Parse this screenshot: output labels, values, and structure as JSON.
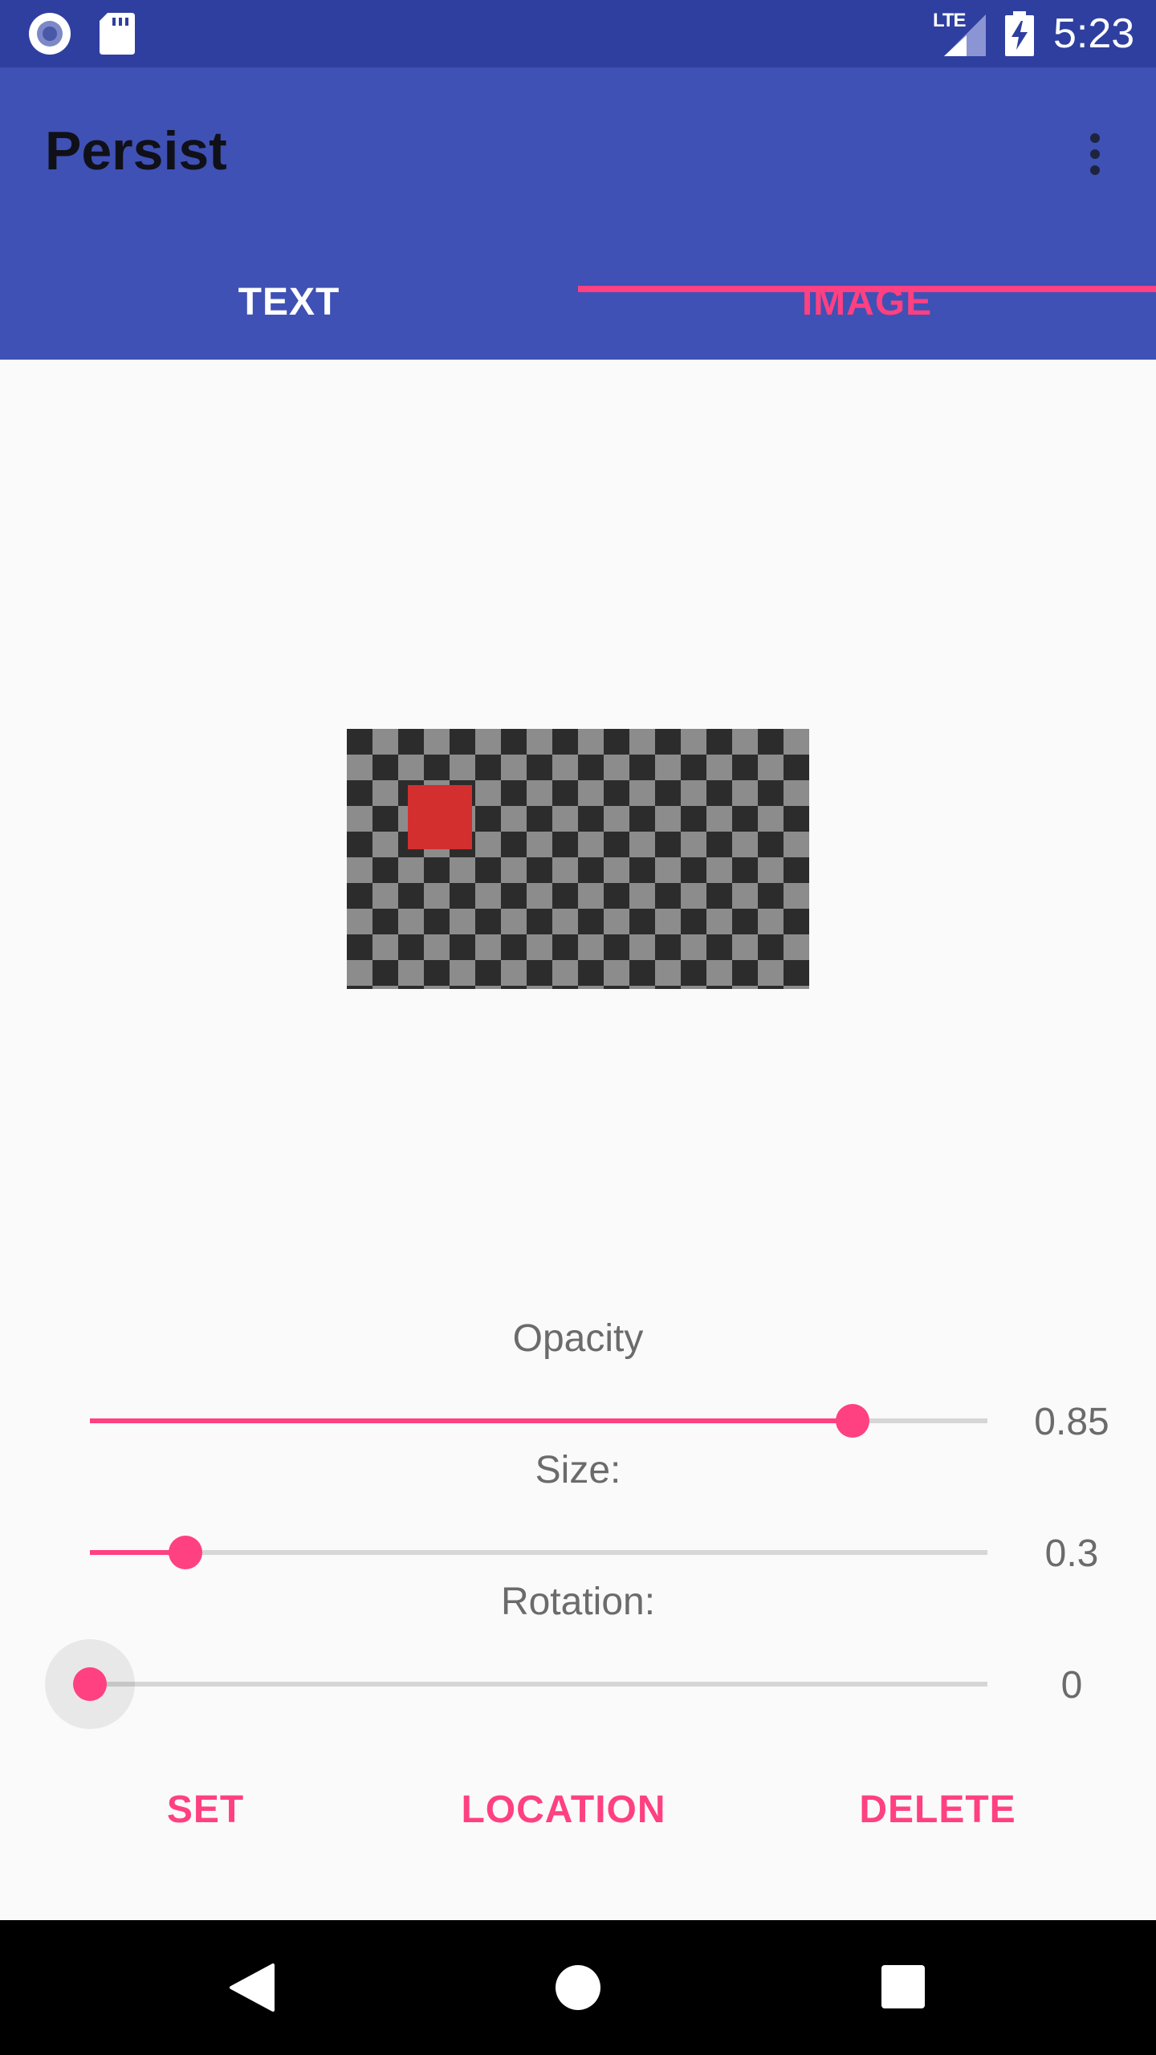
{
  "status_bar": {
    "time": "5:23",
    "network_label": "LTE",
    "icons": [
      "screen-record-icon",
      "sd-card-icon",
      "lte-signal-icon",
      "battery-charging-icon"
    ]
  },
  "app_bar": {
    "title": "Persist",
    "overflow_icon": "more-vert-icon"
  },
  "tabs": [
    {
      "label": "TEXT",
      "selected": false
    },
    {
      "label": "IMAGE",
      "selected": true
    }
  ],
  "controls": {
    "opacity": {
      "label": "Opacity",
      "value": "0.85",
      "fraction": 0.85
    },
    "size": {
      "label": "Size:",
      "value": "0.3",
      "fraction": 0.106
    },
    "rotation": {
      "label": "Rotation:",
      "value": "0",
      "fraction": 0
    }
  },
  "actions": {
    "set": "SET",
    "location": "LOCATION",
    "delete": "DELETE"
  },
  "colors": {
    "primary": "#3f51b5",
    "primary_dark": "#2f3f9f",
    "accent": "#ff4081"
  },
  "nav_bar": {
    "icons": [
      "back-icon",
      "home-icon",
      "recents-icon"
    ]
  }
}
